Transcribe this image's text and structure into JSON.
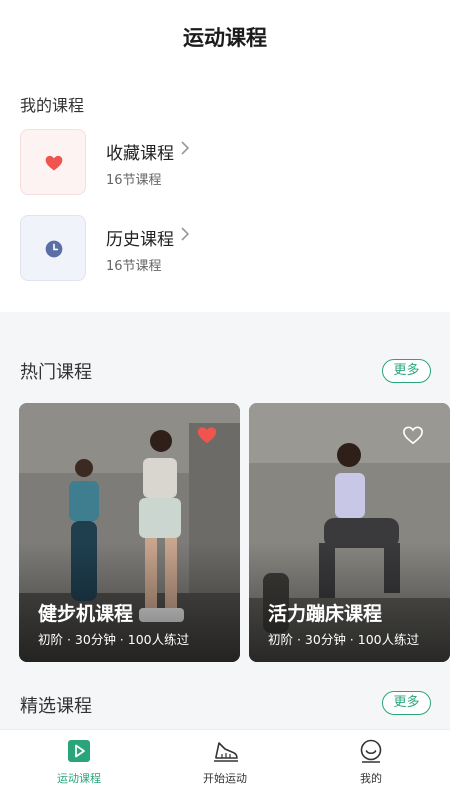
{
  "header": {
    "title": "运动课程"
  },
  "my_courses": {
    "title": "我的课程",
    "items": [
      {
        "name": "收藏课程",
        "count": "16节课程",
        "icon": "heart-icon"
      },
      {
        "name": "历史课程",
        "count": "16节课程",
        "icon": "clock-icon"
      }
    ]
  },
  "hot": {
    "title": "热门课程",
    "more": "更多",
    "cards": [
      {
        "title": "健步机课程",
        "meta": "初阶 · 30分钟 · 100人练过",
        "favorited": true
      },
      {
        "title": "活力蹦床课程",
        "meta": "初阶 · 30分钟 · 100人练过",
        "favorited": false
      }
    ]
  },
  "featured": {
    "title": "精选课程",
    "more": "更多"
  },
  "tabbar": {
    "tabs": [
      {
        "label": "运动课程",
        "icon": "play-icon",
        "active": true
      },
      {
        "label": "开始运动",
        "icon": "shoe-icon",
        "active": false
      },
      {
        "label": "我的",
        "icon": "profile-icon",
        "active": false
      }
    ]
  },
  "colors": {
    "accent": "#2aa57a",
    "heart": "#f0544f",
    "clock": "#5a6fa8"
  }
}
